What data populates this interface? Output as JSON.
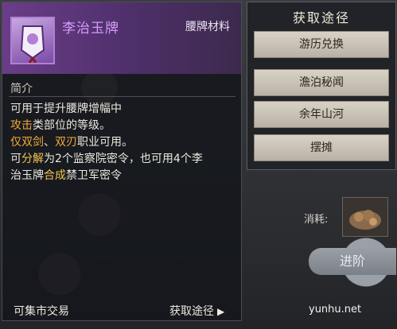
{
  "item": {
    "name": "李治玉牌",
    "type": "腰牌材料",
    "section_title": "简介",
    "description": [
      [
        {
          "t": "可用于提升腰牌增幅中",
          "c": ""
        }
      ],
      [
        {
          "t": "攻击",
          "c": "hl-orange"
        },
        {
          "t": "类部位的等级。",
          "c": ""
        }
      ],
      [
        {
          "t": "仅双剑",
          "c": "hl-orange"
        },
        {
          "t": "、",
          "c": ""
        },
        {
          "t": "双刃",
          "c": "hl-orange"
        },
        {
          "t": "职业可用。",
          "c": ""
        }
      ],
      [
        {
          "t": "可",
          "c": ""
        },
        {
          "t": "分解",
          "c": "hl-yellow"
        },
        {
          "t": "为2个监察院密令，也可用4个李",
          "c": ""
        }
      ],
      [
        {
          "t": "治玉牌",
          "c": ""
        },
        {
          "t": "合成",
          "c": "hl-yellow"
        },
        {
          "t": "禁卫军密令",
          "c": ""
        }
      ]
    ],
    "footer_left": "可集市交易",
    "footer_right": "获取途径",
    "footer_right_icon": "chevron-right-icon"
  },
  "acquire_panel": {
    "title": "获取途径",
    "buttons": [
      "游历兑换",
      "澹泊秘闻",
      "余年山河",
      "摆摊"
    ]
  },
  "background": {
    "consume_label": "消耗:",
    "advance_label": "进阶"
  },
  "watermark": "yunhu.net",
  "colors": {
    "name": "#d59bf7",
    "highlight_orange": "#f0a93a",
    "highlight_yellow": "#f4c64a"
  }
}
